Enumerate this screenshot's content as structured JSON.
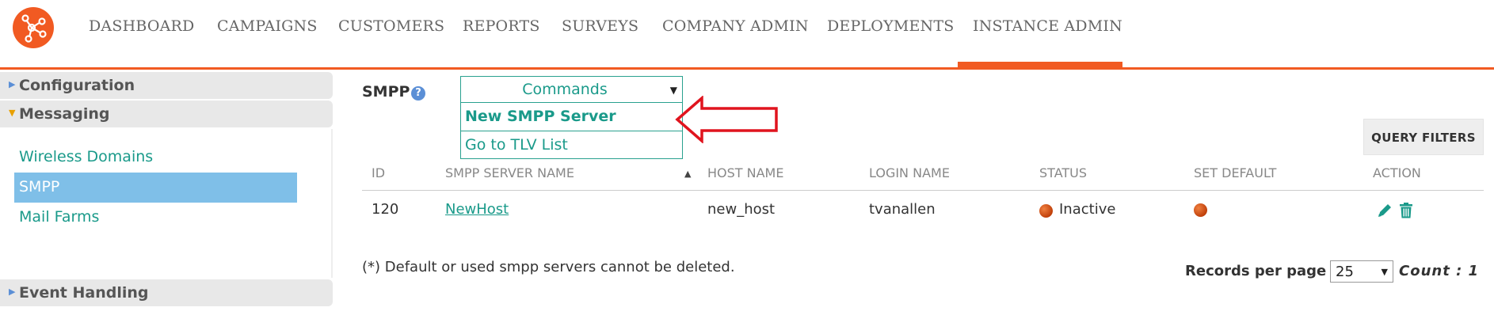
{
  "colors": {
    "accent": "#f15a22",
    "link": "#1a9a8a",
    "selected": "#7fbfe8",
    "status_dot": "#d9541b"
  },
  "nav": {
    "items": [
      "DASHBOARD",
      "CAMPAIGNS",
      "CUSTOMERS",
      "REPORTS",
      "SURVEYS",
      "COMPANY ADMIN",
      "DEPLOYMENTS",
      "INSTANCE ADMIN"
    ],
    "active": "INSTANCE ADMIN"
  },
  "sidebar": {
    "configuration": "Configuration",
    "messaging": "Messaging",
    "items": [
      "Wireless Domains",
      "SMPP",
      "Mail Farms"
    ],
    "selected": "SMPP",
    "event_handling": "Event Handling"
  },
  "main": {
    "title": "SMPP",
    "help_icon": "?",
    "commands": {
      "label": "Commands",
      "options": [
        "New SMPP Server",
        "Go to TLV List"
      ]
    },
    "query_filters": "QUERY FILTERS",
    "table": {
      "headers": [
        "ID",
        "SMPP SERVER NAME",
        "HOST NAME",
        "LOGIN NAME",
        "STATUS",
        "SET DEFAULT",
        "ACTION"
      ],
      "sort_indicator": "▲",
      "rows": [
        {
          "id": "120",
          "name": "NewHost",
          "host": "new_host",
          "login": "tvanallen",
          "status": "Inactive"
        }
      ]
    },
    "footnote": "(*) Default or used smpp servers cannot be deleted.",
    "records_per_page_label": "Records per page",
    "records_per_page_value": "25",
    "count_text": "Count : 1"
  }
}
